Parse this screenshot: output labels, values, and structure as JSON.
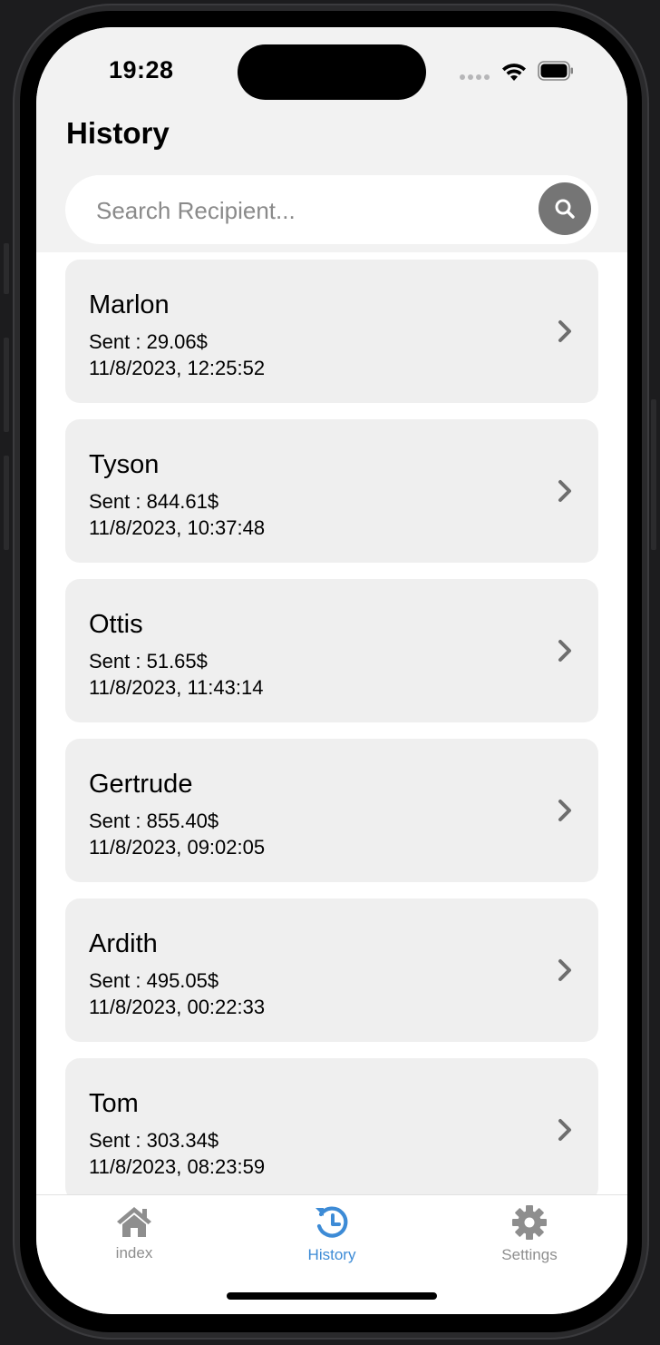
{
  "status_bar": {
    "time": "19:28"
  },
  "header": {
    "title": "History"
  },
  "search": {
    "placeholder": "Search Recipient...",
    "value": ""
  },
  "transactions": [
    {
      "name": "Marlon",
      "amount": "Sent : 29.06$",
      "date": "11/8/2023, 12:25:52"
    },
    {
      "name": "Tyson",
      "amount": "Sent : 844.61$",
      "date": "11/8/2023, 10:37:48"
    },
    {
      "name": "Ottis",
      "amount": "Sent : 51.65$",
      "date": "11/8/2023, 11:43:14"
    },
    {
      "name": "Gertrude",
      "amount": "Sent : 855.40$",
      "date": "11/8/2023, 09:02:05"
    },
    {
      "name": "Ardith",
      "amount": "Sent : 495.05$",
      "date": "11/8/2023, 00:22:33"
    },
    {
      "name": "Tom",
      "amount": "Sent : 303.34$",
      "date": "11/8/2023, 08:23:59"
    }
  ],
  "tabbar": {
    "tabs": [
      {
        "label": "index",
        "icon": "home-icon",
        "active": false
      },
      {
        "label": "History",
        "icon": "history-icon",
        "active": true
      },
      {
        "label": "Settings",
        "icon": "gear-icon",
        "active": false
      }
    ]
  },
  "colors": {
    "accent": "#3d8bd6",
    "inactive": "#8e8e8e",
    "card": "#efefef",
    "header_bg": "#f2f2f2"
  }
}
